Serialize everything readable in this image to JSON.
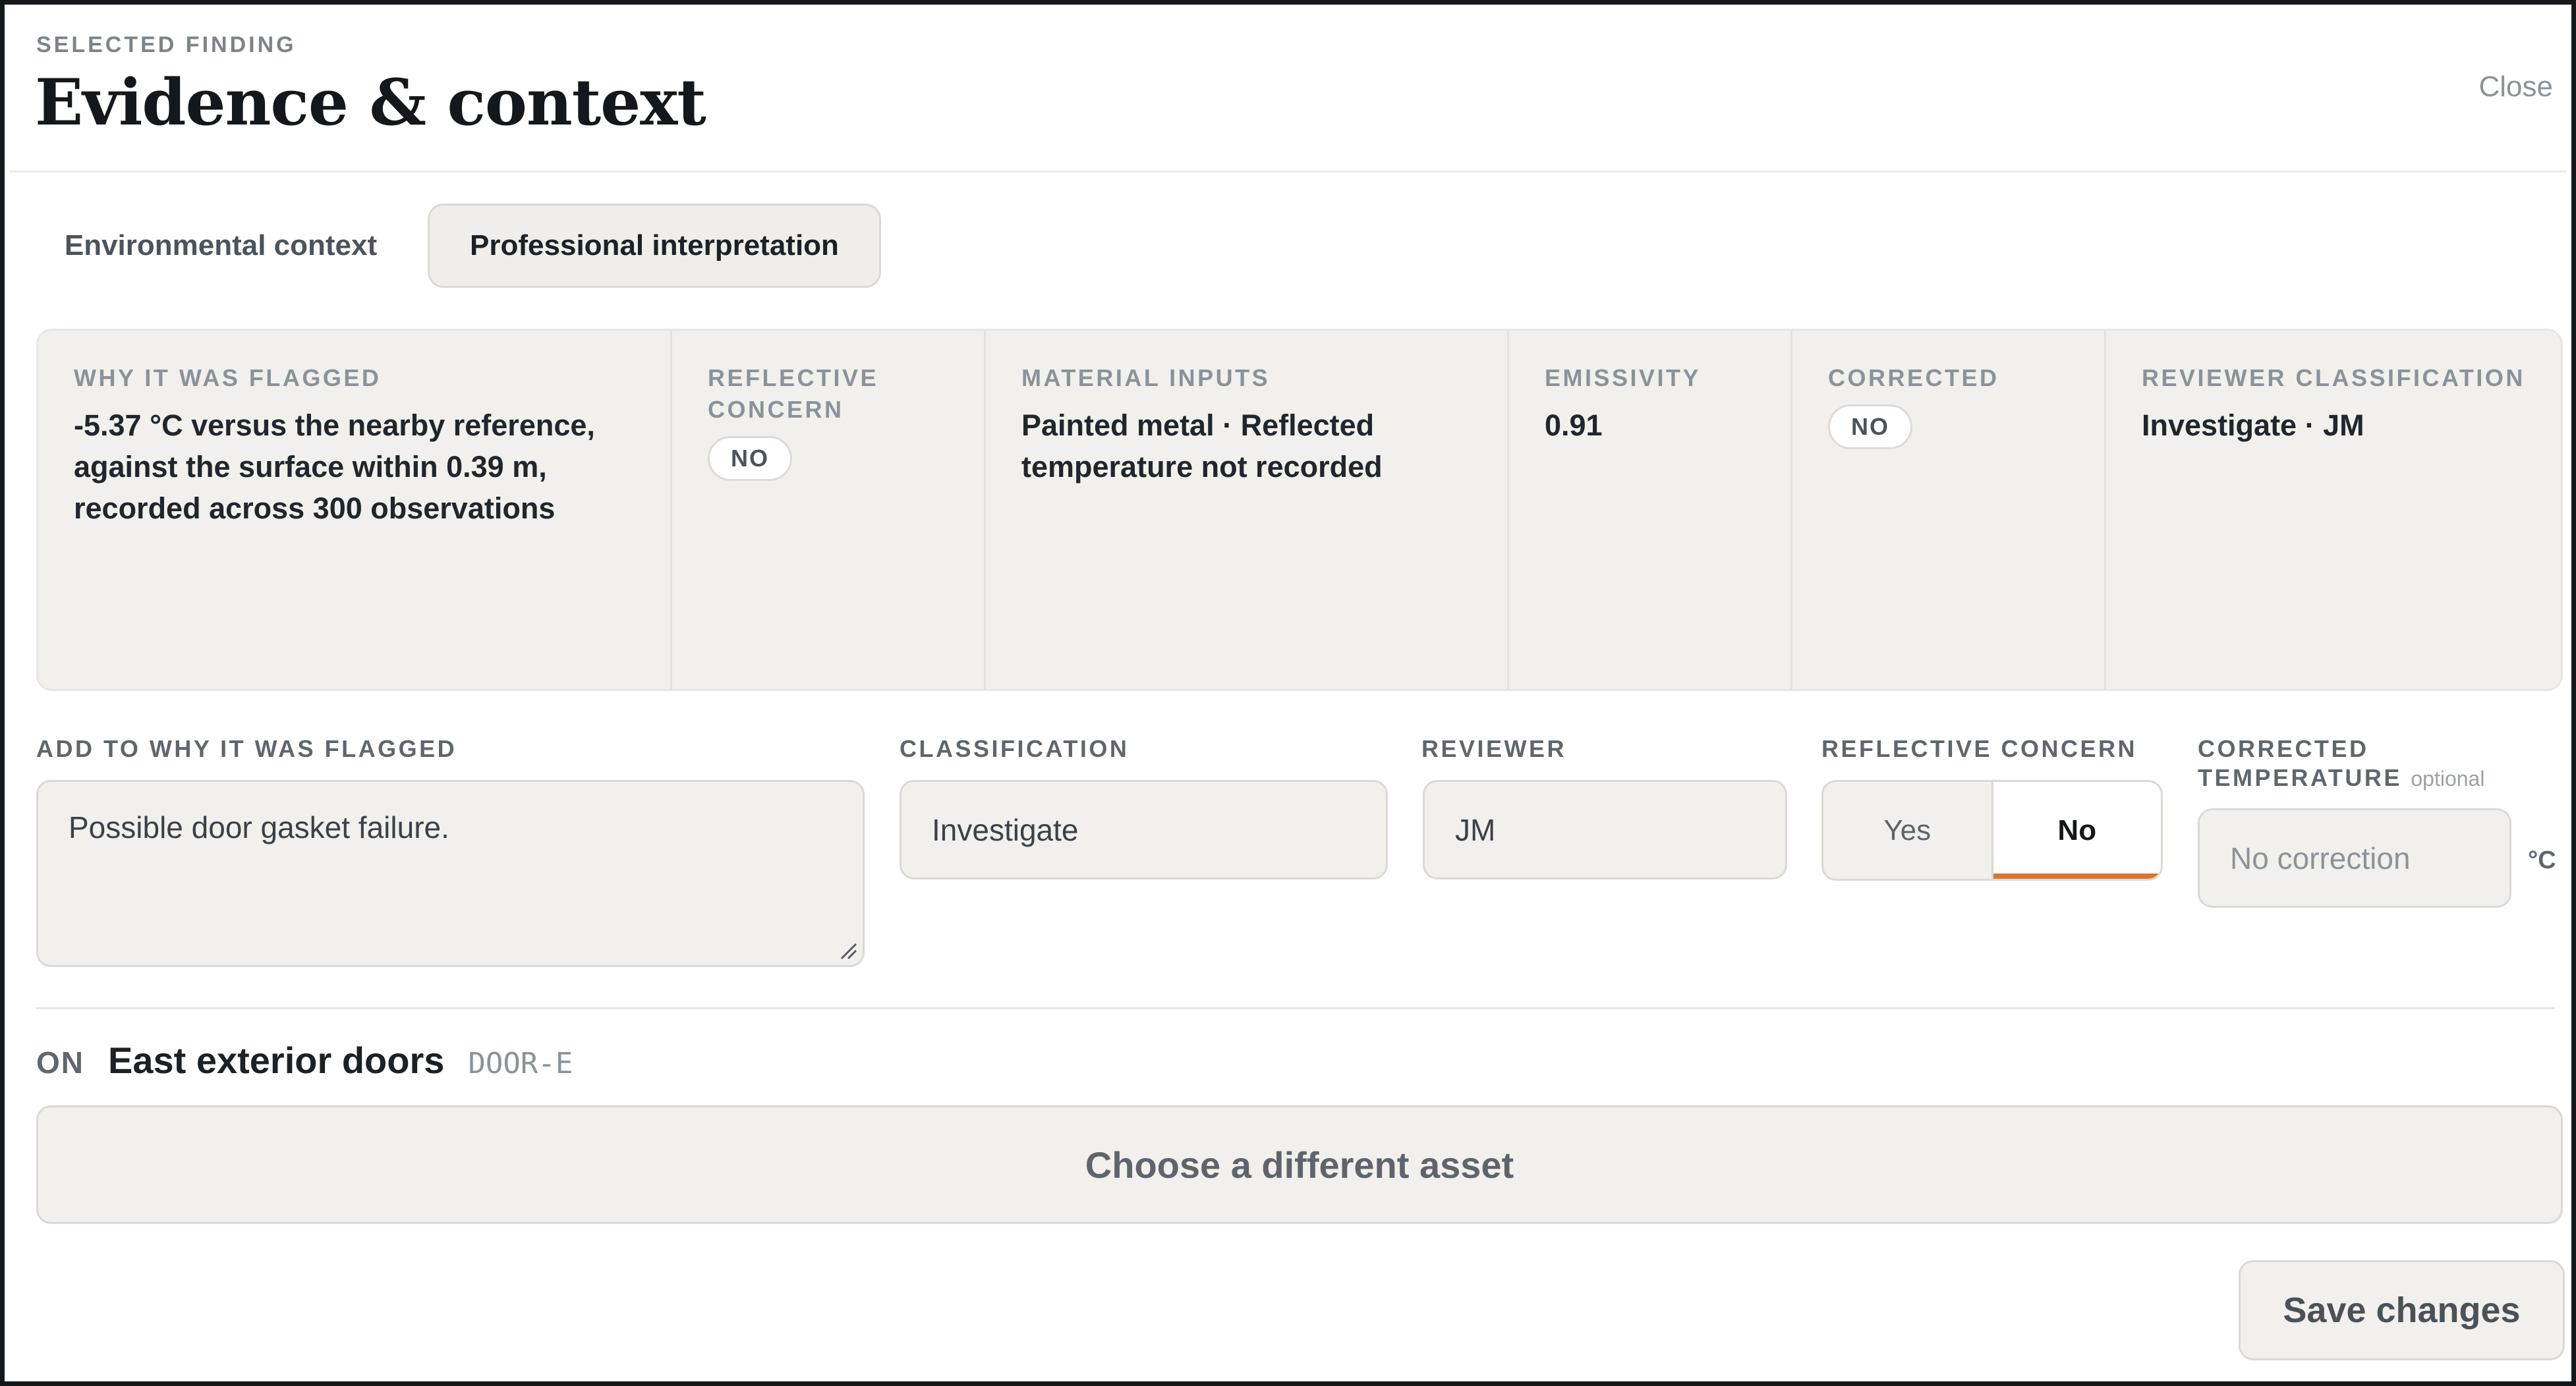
{
  "header": {
    "eyebrow": "SELECTED FINDING",
    "title": "Evidence & context",
    "close_label": "Close"
  },
  "tabs": [
    {
      "label": "Environmental context",
      "active": false
    },
    {
      "label": "Professional interpretation",
      "active": true
    }
  ],
  "summary": {
    "why_flagged": {
      "label": "WHY IT WAS FLAGGED",
      "value": "-5.37 °C versus the nearby reference, against the surface within 0.39 m, recorded across 300 observations"
    },
    "reflective_concern": {
      "label": "REFLECTIVE CONCERN",
      "value": "NO"
    },
    "material_inputs": {
      "label": "MATERIAL INPUTS",
      "value": "Painted metal · Reflected temperature not recorded"
    },
    "emissivity": {
      "label": "EMISSIVITY",
      "value": "0.91"
    },
    "corrected": {
      "label": "CORRECTED",
      "value": "NO"
    },
    "reviewer_classification": {
      "label": "REVIEWER CLASSIFICATION",
      "value": "Investigate · JM"
    }
  },
  "form": {
    "add_to_why": {
      "label": "ADD TO WHY IT WAS FLAGGED",
      "value": "Possible door gasket failure."
    },
    "classification": {
      "label": "CLASSIFICATION",
      "value": "Investigate"
    },
    "reviewer": {
      "label": "REVIEWER",
      "value": "JM"
    },
    "reflective_concern": {
      "label": "REFLECTIVE CONCERN",
      "options": [
        "Yes",
        "No"
      ],
      "selected": "No"
    },
    "corrected_temperature": {
      "label": "CORRECTED TEMPERATURE",
      "optional_label": "optional",
      "placeholder": "No correction",
      "unit": "°C"
    }
  },
  "asset": {
    "on_label": "ON",
    "name": "East exterior doors",
    "code": "DOOR-E",
    "choose_label": "Choose a different asset"
  },
  "actions": {
    "save_label": "Save changes"
  },
  "colors": {
    "accent_underline": "#d9772f",
    "surface": "#f1f0ec",
    "border": "#dcd9d3",
    "title_text": "#14181c"
  }
}
